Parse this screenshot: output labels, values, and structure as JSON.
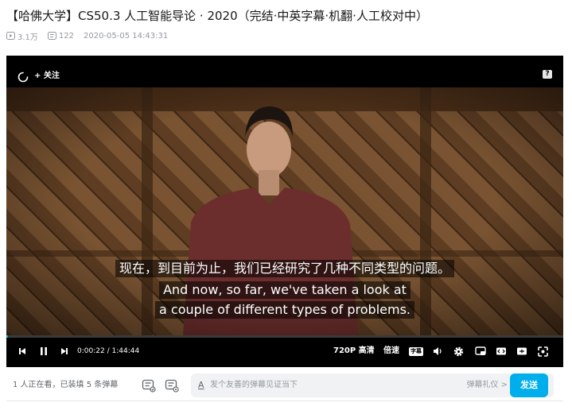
{
  "video": {
    "title": "【哈佛大学】CS50.3 人工智能导论 · 2020（完结·中英字幕·机翻·人工校对中）",
    "views": "3.1万",
    "danmaku_count": "122",
    "publish_time": "2020-05-05 14:43:31"
  },
  "player": {
    "follow_label": "+ 关注",
    "report_label": "?",
    "subtitle_zh": "现在，到目前为止，我们已经研究了几种不同类型的问题。",
    "subtitle_en_1": "And now, so far, we've taken a look at",
    "subtitle_en_2": "a couple of different types of problems.",
    "current_time": "0:00:22",
    "duration": "1:44:44",
    "time_separator": "/",
    "progress_fraction": 0.0035,
    "quality_label": "720P 高清",
    "speed_label": "倍速",
    "subtitle_button_label": "字幕"
  },
  "danmaku_bar": {
    "viewers_text": "1 人正在看，已装填 5 条弹幕",
    "input_icon": "A",
    "input_placeholder": "发个友善的弹幕见证当下",
    "etiquette_label": "弹幕礼仪 >",
    "send_label": "发送"
  },
  "colors": {
    "accent": "#00aeec",
    "title_text": "#18191c",
    "meta_text": "#9499a0"
  },
  "icons": {
    "views": "play-count-icon",
    "danmaku": "danmaku-count-icon",
    "spinner": "loading-spinner-icon",
    "prev": "previous-icon",
    "pause": "pause-icon",
    "next": "next-icon",
    "volume": "volume-icon",
    "settings": "gear-icon",
    "pip": "picture-in-picture-icon",
    "widescreen": "widescreen-icon",
    "webfullscreen": "web-fullscreen-icon",
    "fullscreen": "fullscreen-icon"
  }
}
